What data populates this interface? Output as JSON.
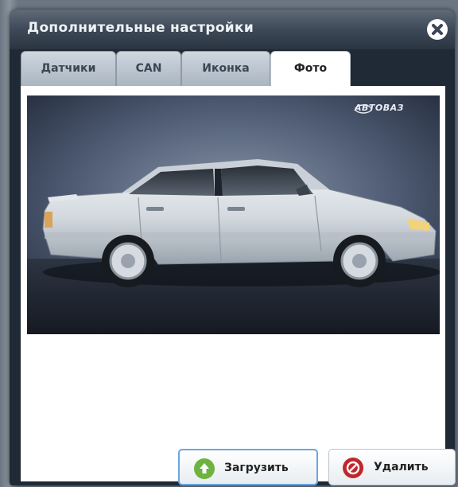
{
  "dialog": {
    "title": "Дополнительные настройки"
  },
  "tabs": [
    {
      "label": "Датчики",
      "active": false
    },
    {
      "label": "CAN",
      "active": false
    },
    {
      "label": "Иконка",
      "active": false
    },
    {
      "label": "Фото",
      "active": true
    }
  ],
  "photo": {
    "brand_watermark": "АВТОВАЗ"
  },
  "buttons": {
    "upload_label": "Загрузить",
    "delete_label": "Удалить"
  },
  "icons": {
    "close": "close-icon",
    "upload": "upload-arrow-icon",
    "delete": "delete-forbidden-icon"
  },
  "colors": {
    "upload_icon": "#6db33f",
    "delete_icon": "#c0272d",
    "title_bar": "#3e4957"
  }
}
